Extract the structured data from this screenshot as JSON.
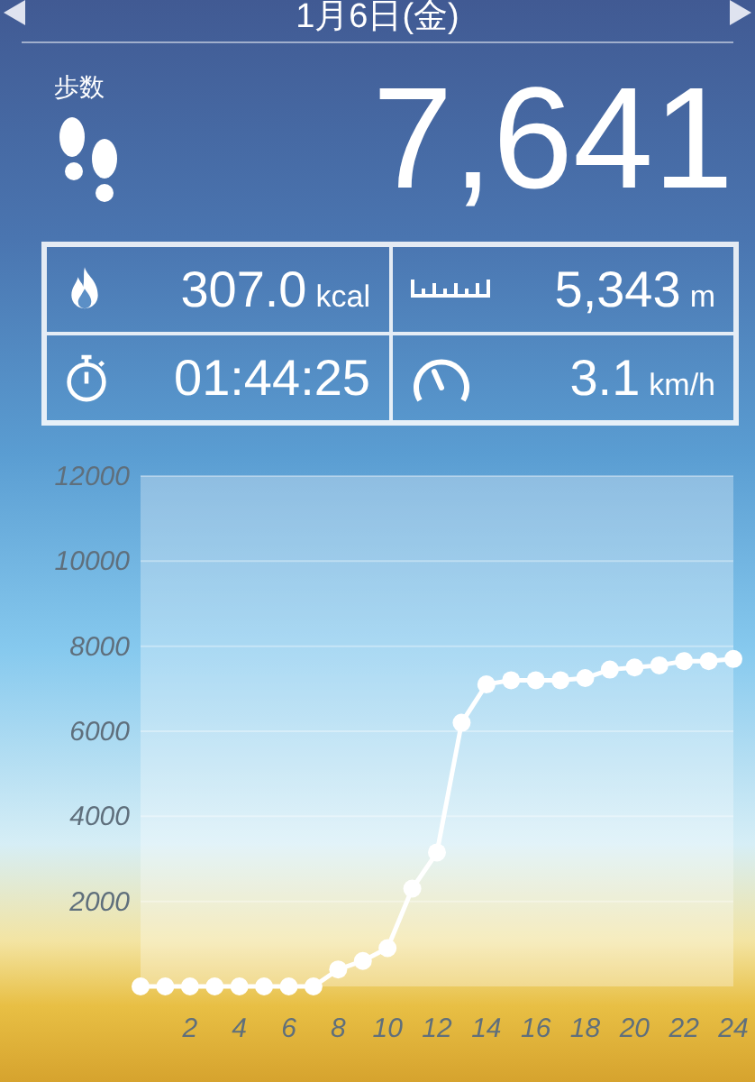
{
  "header": {
    "title": "1月6日(金)"
  },
  "steps": {
    "label": "歩数",
    "value": "7,641"
  },
  "stats": [
    {
      "kind": "calories",
      "value": "307.0",
      "unit": "kcal"
    },
    {
      "kind": "distance",
      "value": "5,343",
      "unit": "m"
    },
    {
      "kind": "duration",
      "value": "01:44:25"
    },
    {
      "kind": "speed",
      "value": "3.1",
      "unit": "km/h"
    }
  ],
  "chart_data": {
    "type": "line",
    "x": [
      0,
      1,
      2,
      3,
      4,
      5,
      6,
      7,
      8,
      9,
      10,
      11,
      12,
      13,
      14,
      15,
      16,
      17,
      18,
      19,
      20,
      21,
      22,
      23,
      24
    ],
    "grid": true,
    "series": [
      {
        "color": "#ffffff",
        "marker": true,
        "values": [
          0,
          0,
          0,
          0,
          0,
          0,
          0,
          0,
          400,
          600,
          900,
          2300,
          3150,
          6200,
          7100,
          7200,
          7200,
          7200,
          7250,
          7450,
          7500,
          7550,
          7650,
          7650,
          7700
        ]
      }
    ],
    "xlim": [
      0,
      24
    ],
    "ylim": [
      0,
      12000
    ],
    "xticks": [
      2,
      4,
      6,
      8,
      10,
      12,
      14,
      16,
      18,
      20,
      22,
      24
    ],
    "yticks": [
      2000,
      4000,
      6000,
      8000,
      10000,
      12000
    ]
  }
}
